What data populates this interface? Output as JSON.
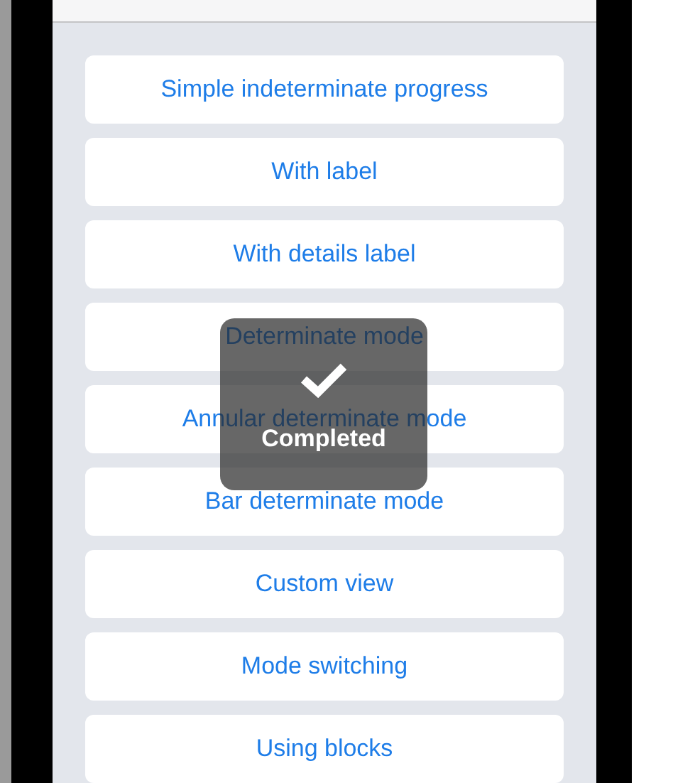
{
  "buttons": [
    "Simple indeterminate progress",
    "With label",
    "With details label",
    "Determinate mode",
    "Annular determinate mode",
    "Bar determinate mode",
    "Custom view",
    "Mode switching",
    "Using blocks"
  ],
  "hud": {
    "kind": "checkmark",
    "label": "Completed"
  }
}
